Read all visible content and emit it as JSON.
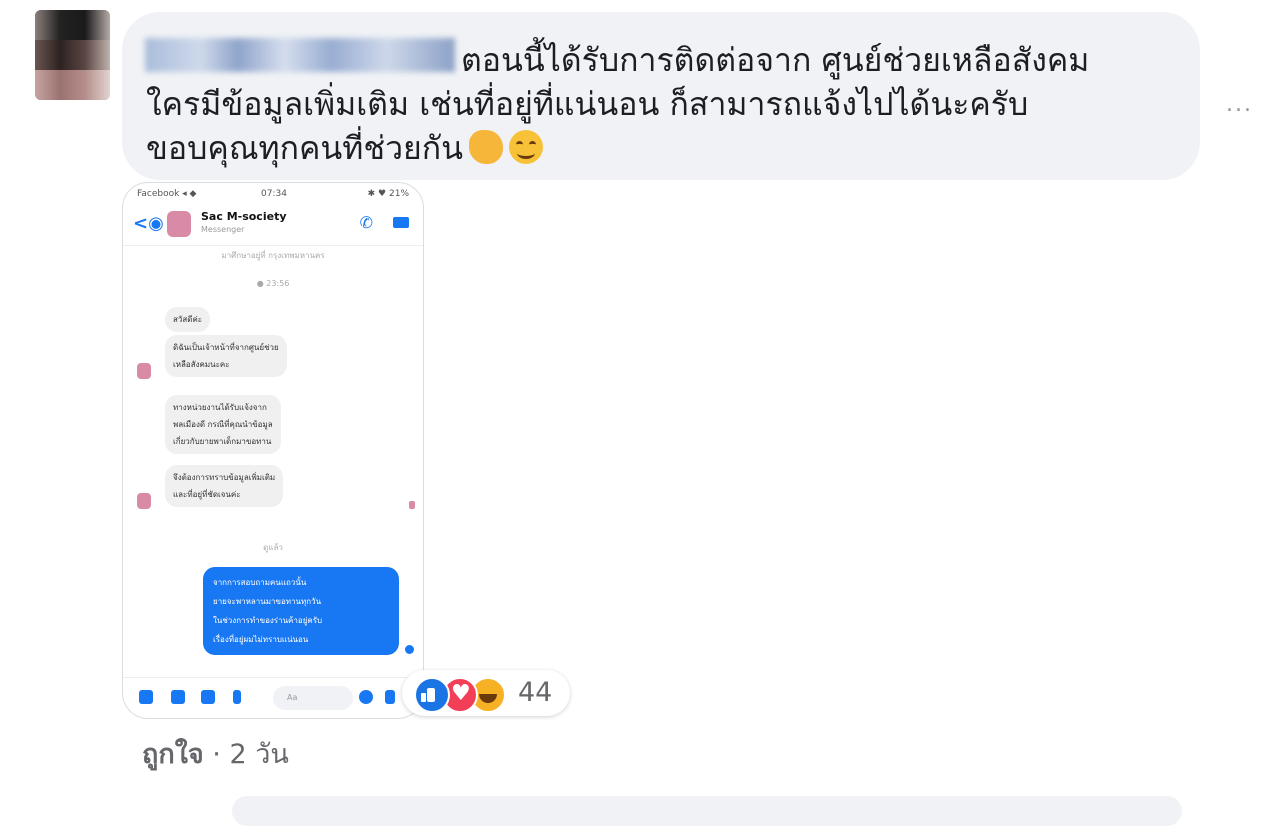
{
  "comment": {
    "text": "ตอนนี้ได้รับการติดต่อจาก ศูนย์ช่วยเหลือสังคม\nใครมีข้อมูลเพิ่มเติม เช่นที่อยู่ที่แน่นอน ก็สามารถแจ้งไปได้นะครับ\nขอบคุณทุกคนที่ช่วยกัน",
    "emoji": [
      "clapping-hands",
      "smiling-face"
    ],
    "more": "..."
  },
  "screenshot": {
    "status_left": "Facebook ◂ ◆",
    "status_time": "07:34",
    "status_right": "✱ ♥ 21%",
    "contact_name": "Sac M-society",
    "contact_sub": "Messenger",
    "page_note": "มาศึกษาอยู่ที่ กรุงเทพมหานคร",
    "time_top": "● 23:56",
    "msg1": "สวัสดีค่ะ",
    "msg2": "ดิฉันเป็นเจ้าหน้าที่จากศูนย์ช่วย\nเหลือสังคมนะคะ",
    "msg3": "ทางหน่วยงานได้รับแจ้งจาก\nพลเมืองดี กรณีที่คุณนำข้อมูล\nเกี่ยวกับยายพาเด็กมาขอทาน",
    "msg4": "จึงต้องการทราบข้อมูลเพิ่มเติม\nและที่อยู่ที่ชัดเจนค่ะ",
    "time_mid": "ดูแล้ว",
    "msg_out": "จากการสอบถามคนแถวนั้น\nยายจะพาหลานมาขอทานทุกวัน\nในช่วงการทำของร่านค้าอยู่ครับ\nเรื่องที่อยู่ผมไม่ทราบแน่นอน",
    "input_placeholder": "Aa"
  },
  "reactions": {
    "types": [
      "like",
      "love",
      "haha"
    ],
    "count": "44"
  },
  "actions": {
    "like": "ถูกใจ",
    "separator": " · ",
    "age": "2 วัน"
  }
}
